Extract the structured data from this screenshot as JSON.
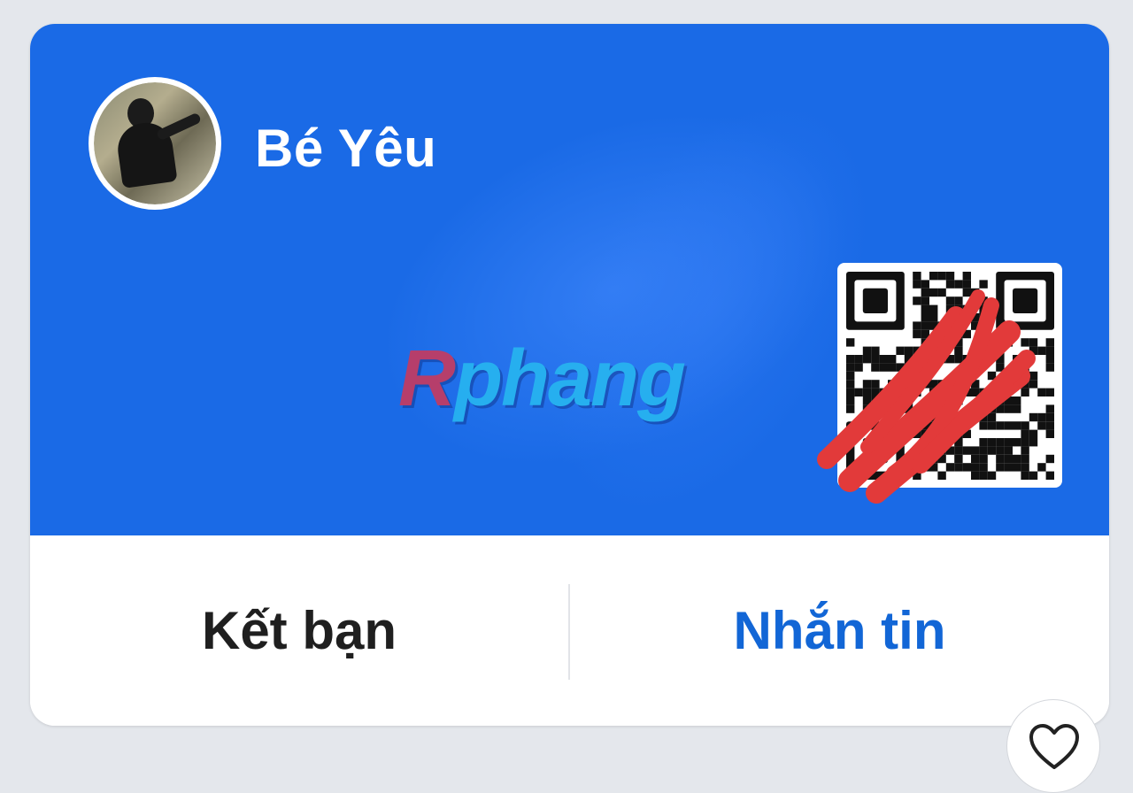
{
  "profile": {
    "name": "Bé Yêu",
    "avatar_icon": "user-avatar-photo"
  },
  "watermark": {
    "first": "R",
    "rest": "phang"
  },
  "qr_code": {
    "icon": "qr-code-icon",
    "redaction_color": "#e23a3a"
  },
  "actions": {
    "add_friend_label": "Kết bạn",
    "message_label": "Nhắn tin"
  },
  "like_button": {
    "icon": "heart-icon"
  },
  "colors": {
    "banner": "#1a6ae6",
    "message_text": "#1266d6",
    "friend_text": "#1f1f1f",
    "background": "#e4e7ec"
  }
}
